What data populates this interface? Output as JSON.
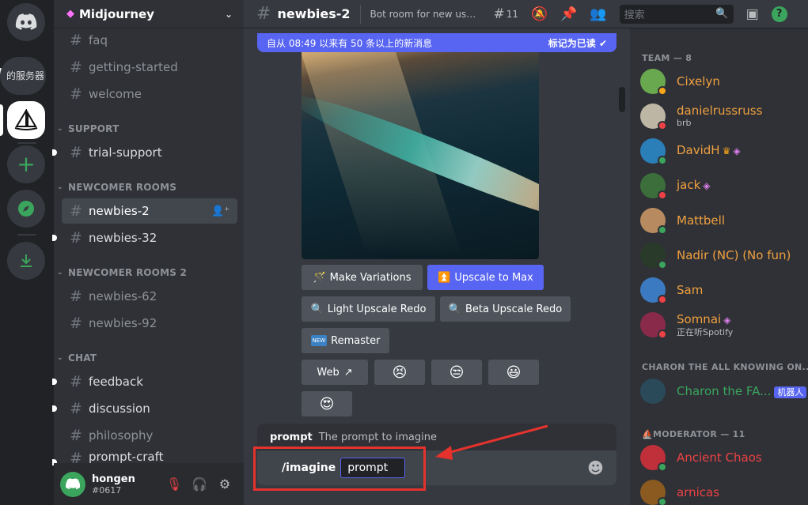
{
  "rail": {
    "servers": [
      {
        "name": "discord-home-icon"
      },
      {
        "text": "的服务器"
      },
      {
        "name": "midjourney-server-icon"
      },
      {
        "name": "add-server-icon"
      },
      {
        "name": "explore-icon"
      },
      {
        "name": "download-icon"
      }
    ]
  },
  "guild": {
    "name": "Midjourney"
  },
  "channels": {
    "faq": "faq",
    "getting_started": "getting-started",
    "welcome": "welcome",
    "cat_support": "SUPPORT",
    "trial_support": "trial-support",
    "cat_newcomer": "NEWCOMER ROOMS",
    "newbies_2": "newbies-2",
    "newbies_32": "newbies-32",
    "cat_newcomer2": "NEWCOMER ROOMS 2",
    "newbies_62": "newbies-62",
    "newbies_92": "newbies-92",
    "cat_chat": "CHAT",
    "feedback": "feedback",
    "discussion": "discussion",
    "philosophy": "philosophy",
    "prompt_craft": "prompt-craft"
  },
  "user": {
    "name": "hongen",
    "tag": "#0617"
  },
  "header": {
    "channel": "newbies-2",
    "topic": "Bot room for new users...",
    "threads_count": "11",
    "search_placeholder": "搜索"
  },
  "banner": {
    "text": "自从 08:49 以来有 50 条以上的新消息",
    "mark_read": "标记为已读"
  },
  "buttons": {
    "make_variations": "Make Variations",
    "upscale_max": "Upscale to Max",
    "light_redo": "Light Upscale Redo",
    "beta_redo": "Beta Upscale Redo",
    "remaster": "Remaster",
    "remaster_tag": "NEW",
    "web": "Web"
  },
  "reactions": [
    "😣",
    "😒",
    "😃",
    "😍"
  ],
  "command_hint": {
    "name": "prompt",
    "desc": "The prompt to imagine"
  },
  "composer": {
    "command": "/imagine",
    "option": "prompt"
  },
  "members": {
    "team_header": "TEAM — 8",
    "team": [
      {
        "name": "Cixelyn",
        "color": "#f0a040",
        "status": "#faa61a",
        "avatar": "#6aa84f"
      },
      {
        "name": "danielrussruss",
        "sub": "brb",
        "color": "#f0a040",
        "status": "#ed4245",
        "avatar": "#bdb6a4"
      },
      {
        "name": "DavidH",
        "color": "#f0a040",
        "status": "#3ba55d",
        "avatar": "#2b7fb8"
      },
      {
        "name": "jack",
        "color": "#f0a040",
        "status": "#ed4245",
        "avatar": "#3b6e3b"
      },
      {
        "name": "Mattbell",
        "color": "#f0a040",
        "status": "#3ba55d",
        "avatar": "#b88a60"
      },
      {
        "name": "Nadir (NC) (No fun)",
        "color": "#f0a040",
        "status": "#3ba55d",
        "avatar": "#2a3a2a"
      },
      {
        "name": "Sam",
        "color": "#f0a040",
        "status": "#ed4245",
        "avatar": "#3b7ac0"
      },
      {
        "name": "Somnai",
        "sub": "正在听Spotify",
        "color": "#f0a040",
        "status": "#ed4245",
        "avatar": "#8a2a4a"
      }
    ],
    "charon_header": "CHARON THE ALL KNOWING ON...",
    "charon": {
      "name": "Charon the FA...",
      "badge": "机器人",
      "color": "#3ba55d",
      "avatar": "#2a4a5a"
    },
    "mod_header": "MODERATOR — 11",
    "mods": [
      {
        "name": "Ancient Chaos",
        "color": "#ed4245",
        "status": "#3ba55d",
        "avatar": "#c0303a"
      },
      {
        "name": "arnicas",
        "color": "#ed4245",
        "status": "#3ba55d",
        "avatar": "#8a5a20"
      }
    ]
  }
}
